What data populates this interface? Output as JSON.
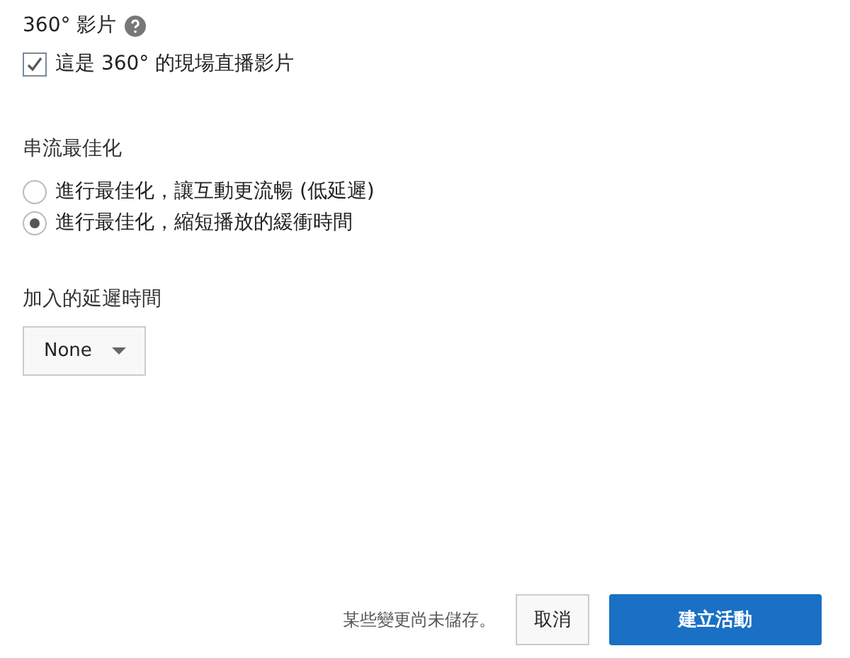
{
  "video360": {
    "title": "360° 影片",
    "checkbox": {
      "label": "這是 360° 的現場直播影片",
      "checked": true
    }
  },
  "optimization": {
    "title": "串流最佳化",
    "options": [
      {
        "label": "進行最佳化，讓互動更流暢 (低延遲)",
        "selected": false
      },
      {
        "label": "進行最佳化，縮短播放的緩衝時間",
        "selected": true
      }
    ]
  },
  "delay": {
    "title": "加入的延遲時間",
    "value": "None"
  },
  "footer": {
    "status": "某些變更尚未儲存。",
    "cancel": "取消",
    "create": "建立活動"
  }
}
